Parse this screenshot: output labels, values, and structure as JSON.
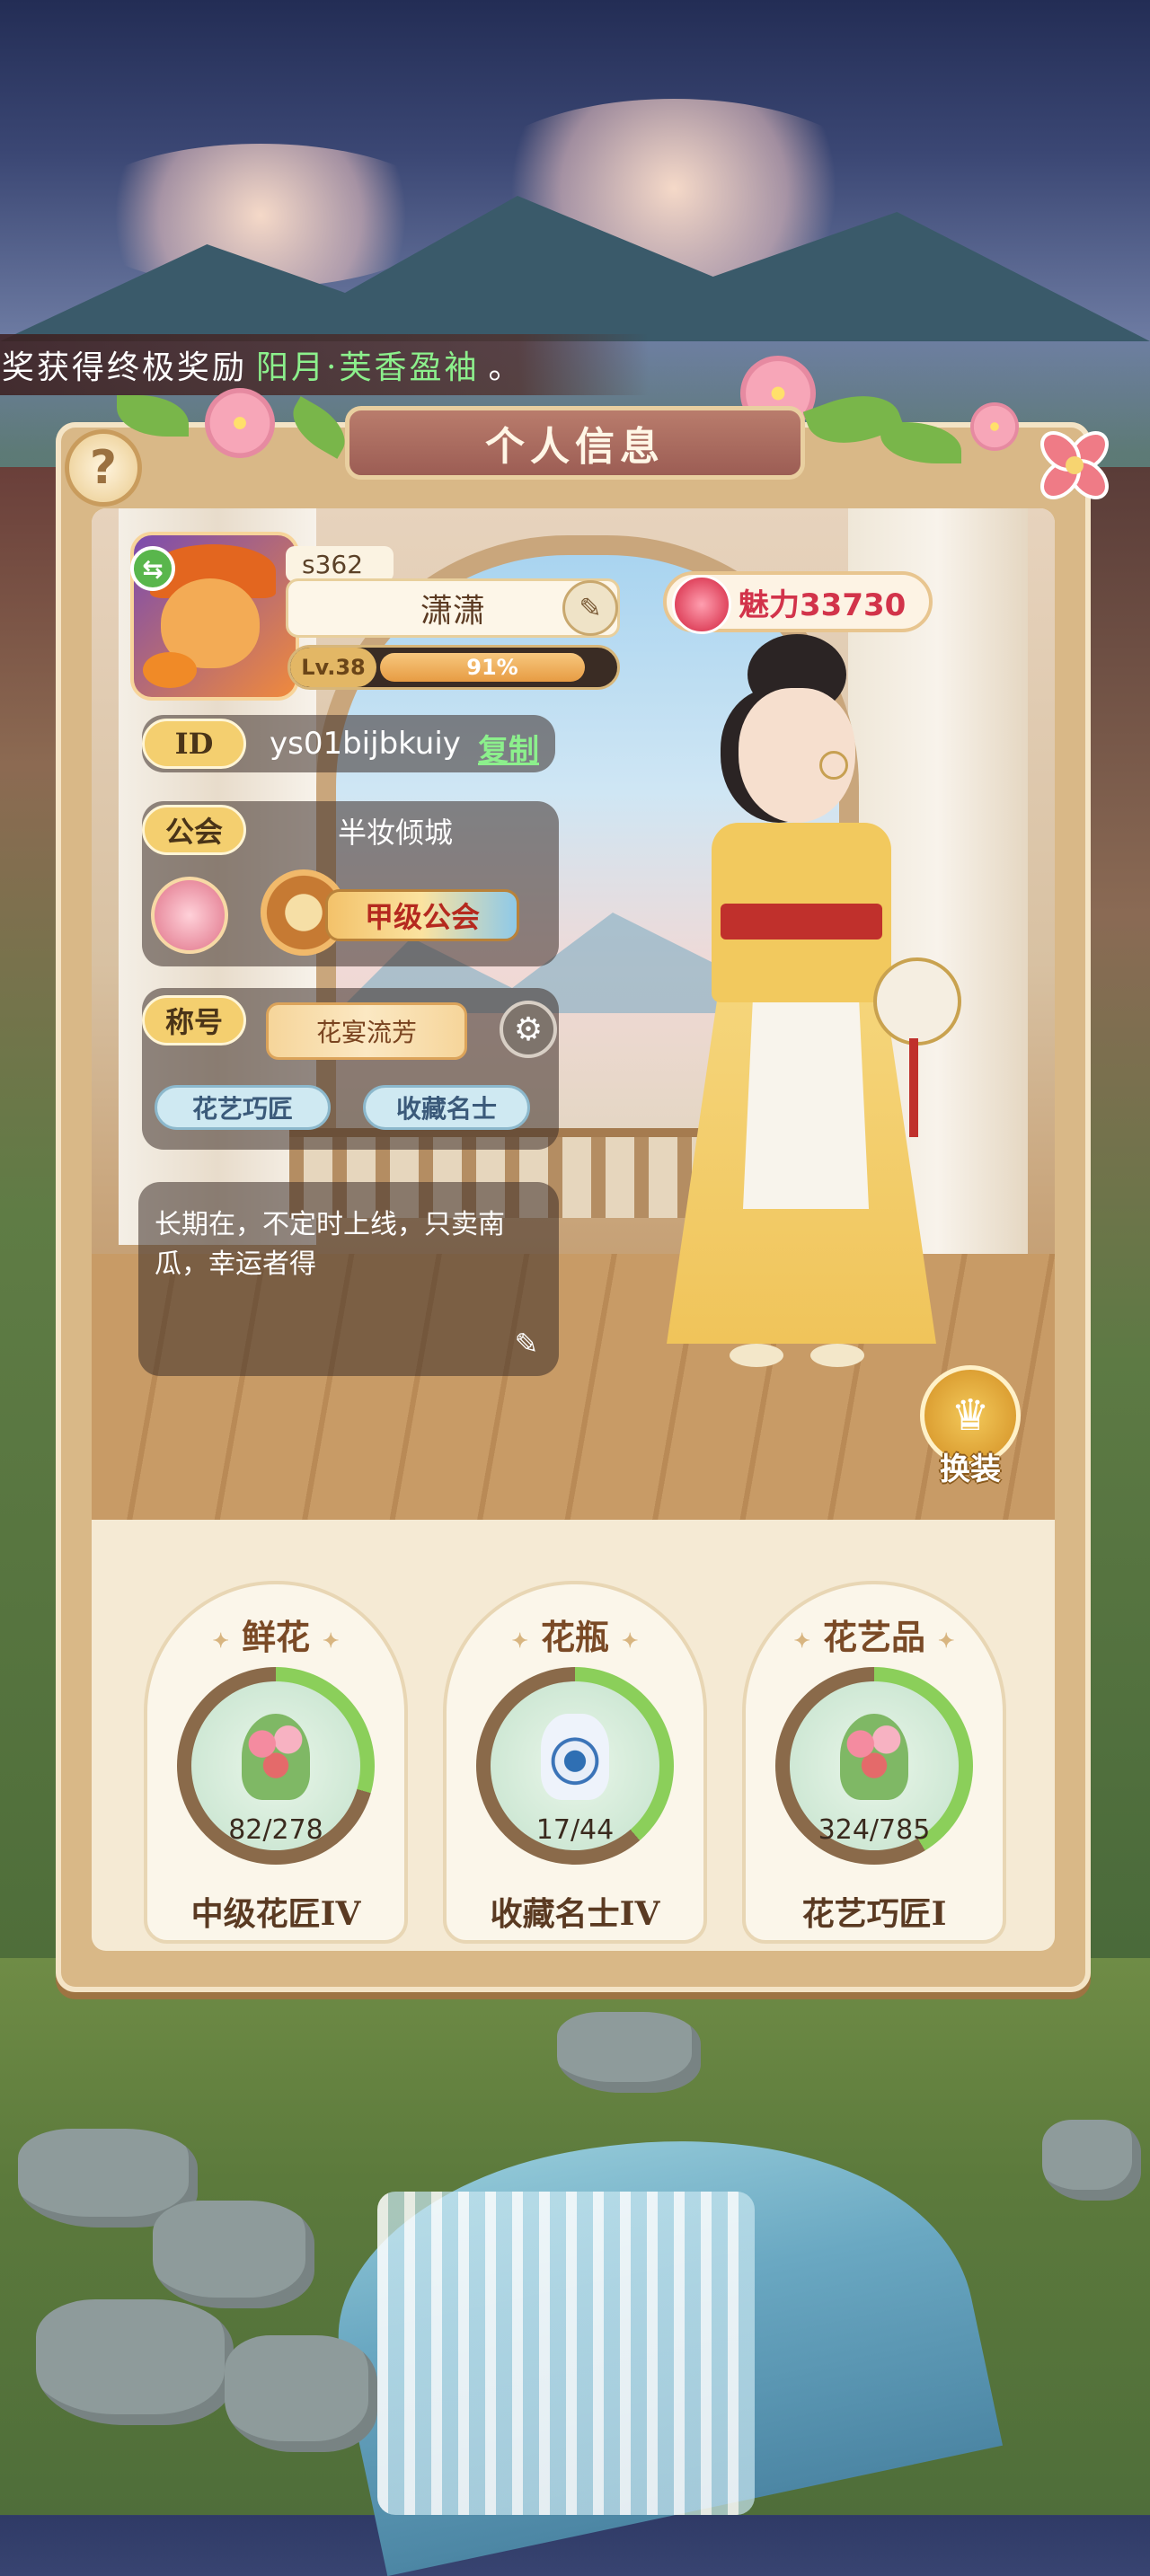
{
  "marquee": {
    "prefix": "奖获得终极奖励",
    "highlight": "阳月·芙香盈袖",
    "suffix": "。"
  },
  "panel": {
    "title": "个人信息",
    "help_label": "?"
  },
  "profile": {
    "server": "s362",
    "name": "潇潇",
    "level_label": "Lv.38",
    "level_progress": "91%",
    "level_fraction": 0.91,
    "charm_label": "魅力33730",
    "id_label": "ID",
    "id_value": "ys01bijbkuiy",
    "copy_label": "复制"
  },
  "guild": {
    "label": "公会",
    "name": "半妆倾城",
    "rank_badge": "甲级公会"
  },
  "honor": {
    "label": "称号",
    "current_title": "花宴流芳",
    "tags": [
      "花艺巧匠",
      "收藏名士"
    ]
  },
  "bio": {
    "text": "长期在，不定时上线，只卖南瓜，幸运者得"
  },
  "dress_up": {
    "label": "换装"
  },
  "collections": [
    {
      "title": "鲜花",
      "count": "82/278",
      "fraction": 0.295,
      "rank": "中级花匠IV",
      "icon": "bouquet-icon"
    },
    {
      "title": "花瓶",
      "count": "17/44",
      "fraction": 0.386,
      "rank": "收藏名士IV",
      "icon": "vase-icon"
    },
    {
      "title": "花艺品",
      "count": "324/785",
      "fraction": 0.413,
      "rank": "花艺巧匠I",
      "icon": "arrangement-icon"
    }
  ],
  "colors": {
    "progress_ring": "#8bcf5a",
    "progress_track": "#8a6a4a",
    "highlight_text": "#8cf08c",
    "charm_text": "#d2334a"
  }
}
